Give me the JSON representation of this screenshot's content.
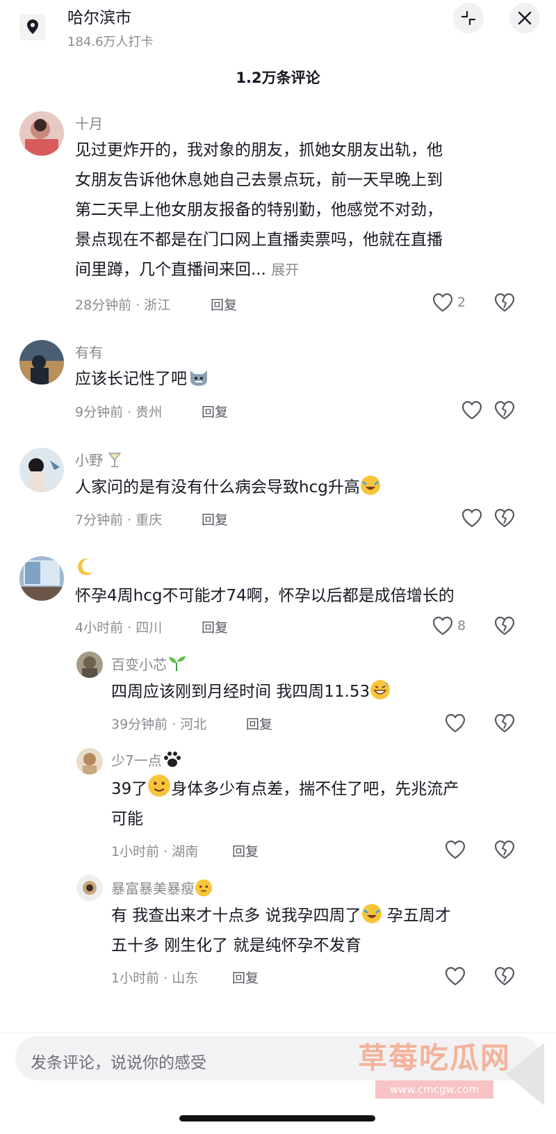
{
  "header": {
    "location_name": "哈尔滨市",
    "checkins": "184.6万人打卡",
    "comment_count": "1.2万条评论",
    "collapse_icon": "collapse-arrows-icon",
    "close_icon": "close-icon"
  },
  "comments": [
    {
      "user": "十月",
      "text": "见过更炸开的，我对象的朋友，抓她女朋友出轨，他\n女朋友告诉他休息她自己去景点玩，前一天早晚上到\n第二天早上他女朋友报备的特别勤，他感觉不对劲，\n景点现在不都是在门口网上直播卖票吗，他就在直播\n间里蹲，几个直播间来回...",
      "expand": "展开",
      "meta": "28分钟前 · 浙江",
      "reply": "回复",
      "likes": "2"
    },
    {
      "user": "有有",
      "text": "应该长记性了吧",
      "meta": "9分钟前 · 贵州",
      "reply": "回复",
      "likes": ""
    },
    {
      "user": "小野",
      "text": "人家问的是有没有什么病会导致hcg升高",
      "meta": "7分钟前 · 重庆",
      "reply": "回复",
      "likes": ""
    },
    {
      "user": "",
      "text": "怀孕4周hcg不可能才74啊，怀孕以后都是成倍增长的",
      "meta": "4小时前 · 四川",
      "reply": "回复",
      "likes": "8"
    }
  ],
  "replies": [
    {
      "user": "百变小芯",
      "text": "四周应该刚到月经时间 我四周11.53",
      "meta": "39分钟前 · 河北",
      "reply": "回复"
    },
    {
      "user": "少7一点",
      "text_a": "39了",
      "text_b": "身体多少有点差，揣不住了吧，先兆流产\n可能",
      "meta": "1小时前 · 湖南",
      "reply": "回复"
    },
    {
      "user": "暴富暴美暴瘦",
      "text_a": "有 我查出来才十点多  说我孕四周了",
      "text_b": " 孕五周才\n五十多  刚生化了 就是纯怀孕不发育",
      "meta": "1小时前 · 山东",
      "reply": "回复"
    }
  ],
  "input": {
    "placeholder": "发条评论，说说你的感受"
  },
  "watermark": {
    "text": "草莓吃瓜网",
    "url": "www.cmcgw.com"
  }
}
